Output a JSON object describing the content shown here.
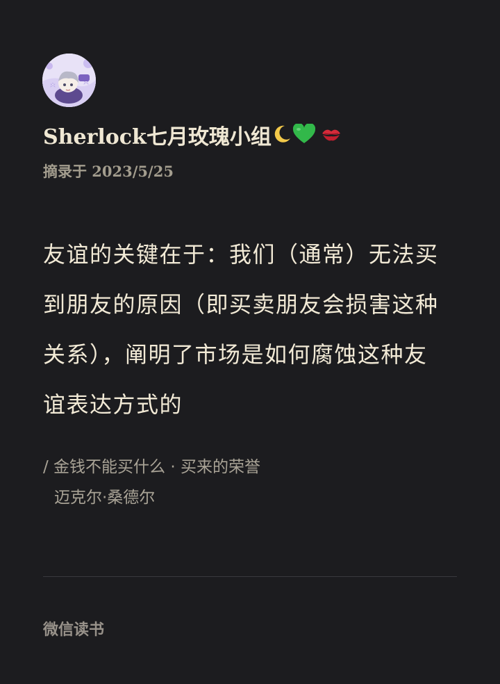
{
  "post": {
    "author_name": "Sherlock七月玫瑰小组",
    "author_emoji": [
      "crescent-moon-emoji",
      "green-heart-emoji",
      "kiss-mark-emoji"
    ],
    "excerpt_meta": "摘录于 2023/5/25"
  },
  "quote": {
    "lines": [
      "友谊的关键在于：我们（通常）无法买",
      "到朋友的原因（即买卖朋友会损害这种",
      "关系），阐明了市场是如何腐蚀这种友",
      "谊表达方式的"
    ]
  },
  "source": {
    "book_line": "/ 金钱不能买什么 · 买来的荣誉",
    "author": "迈克尔·桑德尔"
  },
  "footer": {
    "app_name": "微信读书"
  },
  "colors": {
    "background": "#1c1c1f",
    "primary_text": "#f2ead6",
    "secondary_text": "#a39d8e",
    "divider": "#3a3a3e"
  }
}
